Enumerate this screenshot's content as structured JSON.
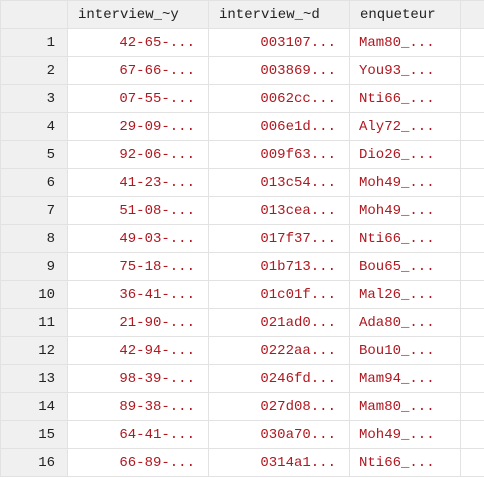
{
  "columns": [
    "interview_~y",
    "interview_~d",
    "enqueteur"
  ],
  "text_color": "#b0171f",
  "rows": [
    {
      "n": "1",
      "a": "42-65-...",
      "b": "003107...",
      "c": "Mam80_..."
    },
    {
      "n": "2",
      "a": "67-66-...",
      "b": "003869...",
      "c": "You93_..."
    },
    {
      "n": "3",
      "a": "07-55-...",
      "b": "0062cc...",
      "c": "Nti66_..."
    },
    {
      "n": "4",
      "a": "29-09-...",
      "b": "006e1d...",
      "c": "Aly72_..."
    },
    {
      "n": "5",
      "a": "92-06-...",
      "b": "009f63...",
      "c": "Dio26_..."
    },
    {
      "n": "6",
      "a": "41-23-...",
      "b": "013c54...",
      "c": "Moh49_..."
    },
    {
      "n": "7",
      "a": "51-08-...",
      "b": "013cea...",
      "c": "Moh49_..."
    },
    {
      "n": "8",
      "a": "49-03-...",
      "b": "017f37...",
      "c": "Nti66_..."
    },
    {
      "n": "9",
      "a": "75-18-...",
      "b": "01b713...",
      "c": "Bou65_..."
    },
    {
      "n": "10",
      "a": "36-41-...",
      "b": "01c01f...",
      "c": "Mal26_..."
    },
    {
      "n": "11",
      "a": "21-90-...",
      "b": "021ad0...",
      "c": "Ada80_..."
    },
    {
      "n": "12",
      "a": "42-94-...",
      "b": "0222aa...",
      "c": "Bou10_..."
    },
    {
      "n": "13",
      "a": "98-39-...",
      "b": "0246fd...",
      "c": "Mam94_..."
    },
    {
      "n": "14",
      "a": "89-38-...",
      "b": "027d08...",
      "c": "Mam80_..."
    },
    {
      "n": "15",
      "a": "64-41-...",
      "b": "030a70...",
      "c": "Moh49_..."
    },
    {
      "n": "16",
      "a": "66-89-...",
      "b": "0314a1...",
      "c": "Nti66_..."
    }
  ]
}
